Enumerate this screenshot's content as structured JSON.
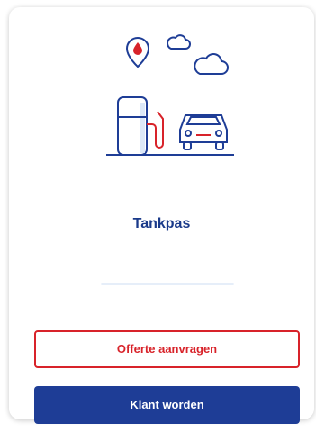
{
  "card": {
    "title": "Tankpas",
    "illustration_icon": "fuel-station-car-icon"
  },
  "actions": {
    "quote_label": "Offerte aanvragen",
    "customer_label": "Klant worden"
  },
  "colors": {
    "brand_blue": "#1e3d96",
    "accent_red": "#d8232a",
    "title_blue": "#1a3a8a"
  }
}
